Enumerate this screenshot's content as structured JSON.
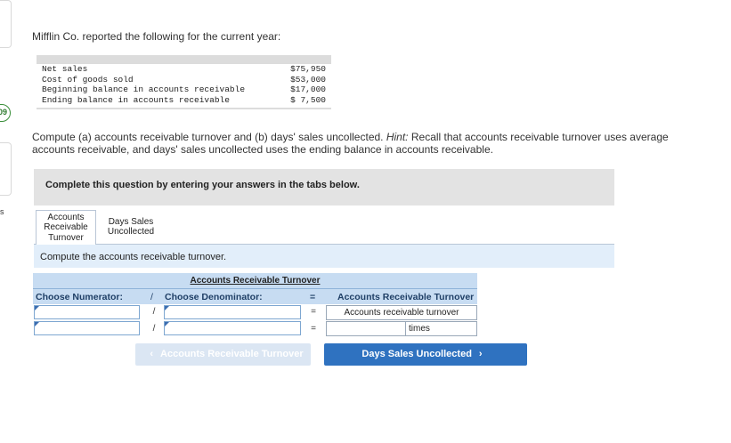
{
  "intro": "Mifflin Co. reported the following for the current year:",
  "rail": {
    "badge": "09",
    "letter": "s"
  },
  "data_rows": [
    {
      "label": "Net sales",
      "value": "$75,950"
    },
    {
      "label": "Cost of goods sold",
      "value": "$53,000"
    },
    {
      "label": "Beginning balance in accounts receivable",
      "value": "$17,000"
    },
    {
      "label": "Ending balance in accounts receivable",
      "value": "$ 7,500"
    }
  ],
  "instructions": {
    "main": "Compute (a) accounts receivable turnover and (b) days' sales uncollected. ",
    "hint_label": "Hint:",
    "hint": " Recall that accounts receivable turnover uses average accounts receivable, and days' sales uncollected uses the ending balance in accounts receivable."
  },
  "banner": "Complete this question by entering your answers in the tabs below.",
  "tabs": [
    {
      "label": "Accounts Receivable Turnover",
      "active": true
    },
    {
      "label": "Days Sales Uncollected",
      "active": false
    }
  ],
  "panel_prompt": "Compute the accounts receivable turnover.",
  "table": {
    "title": "Accounts Receivable Turnover",
    "numerator_header": "Choose Numerator:",
    "divide_symbol": "/",
    "denominator_header": "Choose Denominator:",
    "equals_symbol": "=",
    "result_header": "Accounts Receivable Turnover",
    "rows": [
      {
        "numerator": "",
        "denominator": "",
        "result": "Accounts receivable turnover"
      },
      {
        "numerator": "",
        "denominator": "",
        "result": "",
        "unit": "times"
      }
    ]
  },
  "nav": {
    "prev_label": "Accounts Receivable Turnover",
    "next_label": "Days Sales Uncollected",
    "prev_glyph": "‹",
    "next_glyph": "›"
  },
  "colors": {
    "accent": "#2f72c0",
    "header_bg": "#c7dcf2",
    "panel_bg": "#e2eefa",
    "badge": "#3a8f3a"
  }
}
